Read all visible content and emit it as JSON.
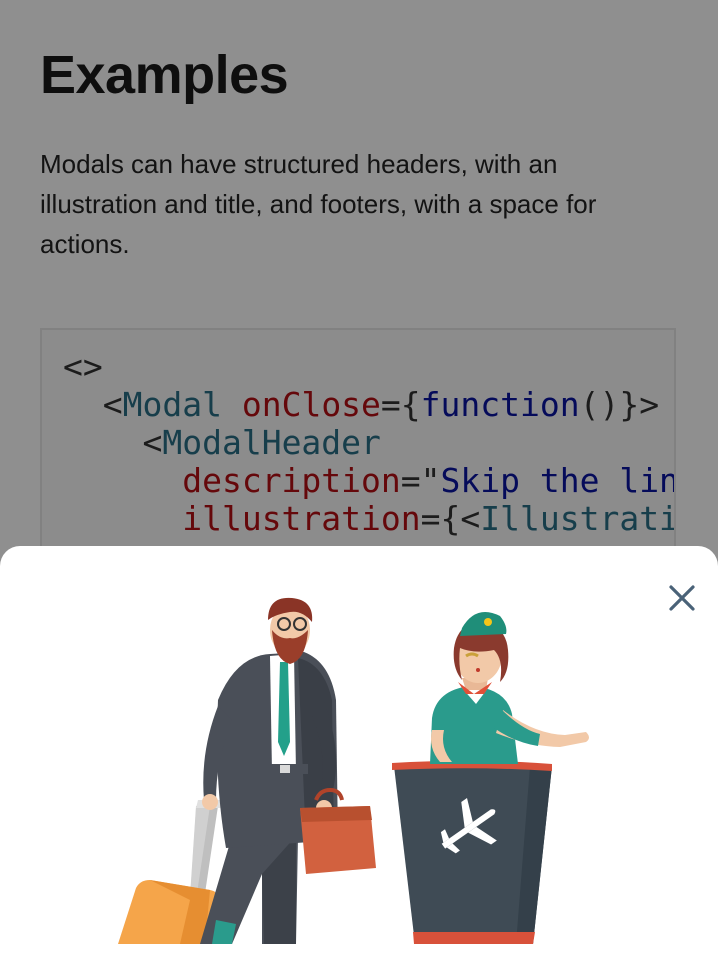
{
  "page": {
    "title": "Examples",
    "intro": "Modals can have structured headers, with an illustration and title, and footers, with a space for actions."
  },
  "code_example": {
    "line1": {
      "open": "<>"
    },
    "line2": {
      "lt": "<",
      "component": "Modal",
      "sp": " ",
      "attr": "onClose",
      "eq": "={",
      "fn": "function",
      "rest": "()}>"
    },
    "line3": {
      "lt": "<",
      "component": "ModalHeader"
    },
    "line4": {
      "attr": "description",
      "eq": "=\"",
      "value": "Skip the lin"
    },
    "line5": {
      "attr": "illustration",
      "eq": "={<",
      "value": "Illustrati"
    }
  },
  "modal": {
    "close_icon": "close-icon",
    "illustration_icon": "airport-checkin-illustration"
  },
  "colors": {
    "backdrop": "rgba(0,0,0,0.44)",
    "close_icon": "#4a6278",
    "code_tag": "#2a6f86",
    "code_attr": "#b40f14",
    "code_keyword": "#0a14a0"
  }
}
